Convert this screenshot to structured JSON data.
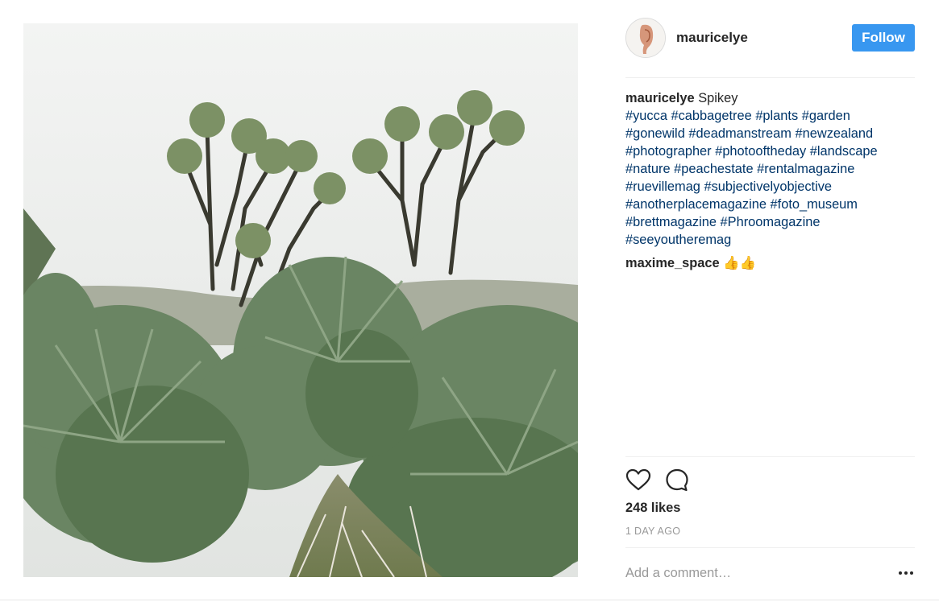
{
  "post": {
    "author": "mauricelye",
    "follow_label": "Follow",
    "caption_user": "mauricelye",
    "caption_text": "Spikey",
    "hashtags": [
      "#yucca",
      "#cabbagetree",
      "#plants",
      "#garden",
      "#gonewild",
      "#deadmanstream",
      "#newzealand",
      "#photographer",
      "#photooftheday",
      "#landscape",
      "#nature",
      "#peachestate",
      "#rentalmagazine",
      "#ruevillemag",
      "#subjectivelyobjective",
      "#anotherplacemagazine",
      "#foto_museum",
      "#brettmagazine",
      "#Phroomagazine",
      "#seeyoutheremag"
    ],
    "comment_user": "maxime_space",
    "comment_text": "👍👍",
    "likes": "248 likes",
    "date": "1 DAY AGO",
    "comment_placeholder": "Add a comment…",
    "more_label": "•••"
  },
  "icons": {
    "like": "heart-icon",
    "comment": "comment-bubble-icon",
    "more": "ellipsis-icon"
  },
  "colors": {
    "follow_bg": "#3897f0",
    "hashtag": "#003569",
    "muted": "#999999"
  }
}
